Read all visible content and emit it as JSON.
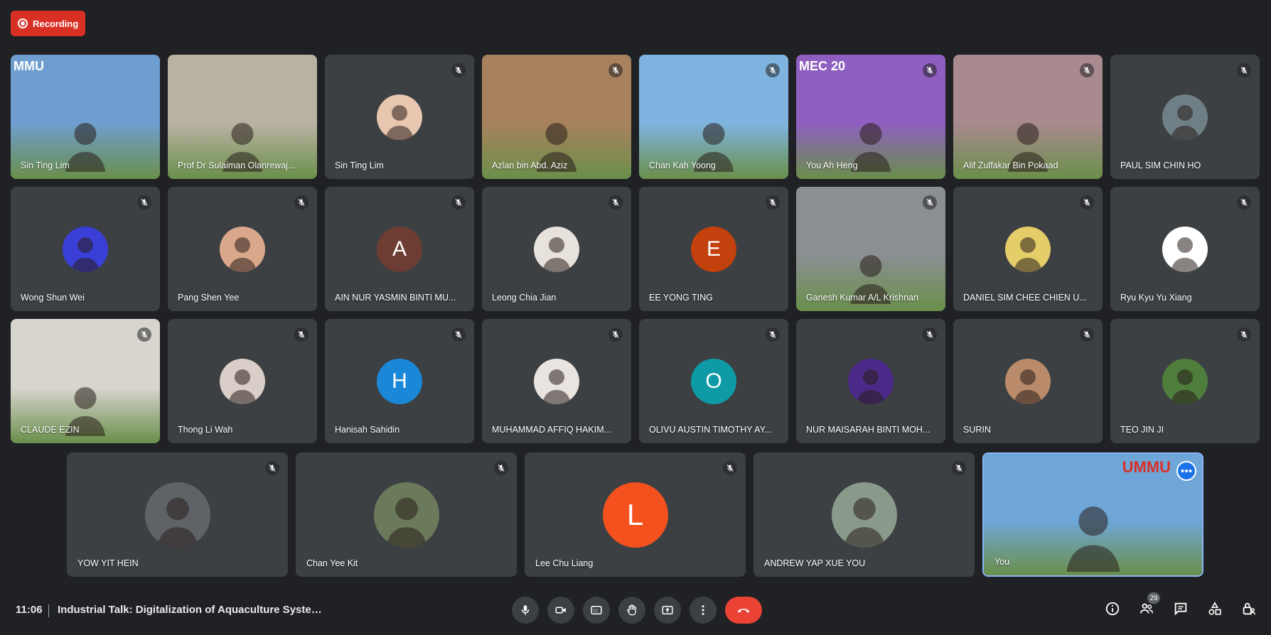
{
  "recording_label": "Recording",
  "tiles": [
    {
      "name": "Sin Ting Lim",
      "kind": "video",
      "bg": "#6e9ecf",
      "logo": "MMU",
      "muted": false
    },
    {
      "name": "Prof Dr Sulaiman Olanrewaj...",
      "kind": "video",
      "bg": "#b9b2a3",
      "muted": false
    },
    {
      "name": "Sin Ting Lim",
      "kind": "photo",
      "avatar_color": "#e8c6b0",
      "muted": true
    },
    {
      "name": "Azlan bin Abd. Aziz",
      "kind": "video",
      "bg": "#a8825e",
      "muted": true
    },
    {
      "name": "Chan Kah Yoong",
      "kind": "video",
      "bg": "#7fb4e0",
      "muted": true
    },
    {
      "name": "You Ah Heng",
      "kind": "video",
      "bg": "#8e5fc0",
      "logo": "MEC 20",
      "muted": true
    },
    {
      "name": "Alif Zulfakar Bin Pokaad",
      "kind": "video",
      "bg": "#a88a8f",
      "muted": true
    },
    {
      "name": "PAUL SIM CHIN HO",
      "kind": "photo",
      "avatar_color": "#6f7f86",
      "muted": true
    },
    {
      "name": "Wong Shun Wei",
      "kind": "photo",
      "avatar_color": "#3a3fd8",
      "muted": true
    },
    {
      "name": "Pang Shen Yee",
      "kind": "photo",
      "avatar_color": "#d9a78a",
      "muted": true
    },
    {
      "name": "AIN NUR YASMIN BINTI MU...",
      "kind": "initial",
      "initial": "A",
      "avatar_color": "#6d3d33",
      "muted": true
    },
    {
      "name": "Leong Chia Jian",
      "kind": "photo",
      "avatar_color": "#e8e2dc",
      "muted": true
    },
    {
      "name": "EE YONG TING",
      "kind": "initial",
      "initial": "E",
      "avatar_color": "#c2410c",
      "muted": true
    },
    {
      "name": "Ganesh Kumar A/L Krishnan",
      "kind": "video",
      "bg": "#8b8f93",
      "muted": true
    },
    {
      "name": "DANIEL SIM CHEE CHIEN U...",
      "kind": "photo",
      "avatar_color": "#e5cd6a",
      "muted": true
    },
    {
      "name": "Ryu Kyu Yu Xiang",
      "kind": "photo",
      "avatar_color": "#ffffff",
      "muted": true
    },
    {
      "name": "CLAUDE EZIN",
      "kind": "video",
      "bg": "#d8d5cf",
      "muted": true
    },
    {
      "name": "Thong Li Wah",
      "kind": "photo",
      "avatar_color": "#d9cfc8",
      "muted": true
    },
    {
      "name": "Hanisah Sahidin",
      "kind": "initial",
      "initial": "H",
      "avatar_color": "#1a88d6",
      "muted": true
    },
    {
      "name": "MUHAMMAD AFFIQ HAKIM...",
      "kind": "photo",
      "avatar_color": "#e9e4e0",
      "muted": true
    },
    {
      "name": "OLIVU AUSTIN TIMOTHY AY...",
      "kind": "initial",
      "initial": "O",
      "avatar_color": "#0f9ba6",
      "muted": true
    },
    {
      "name": "NUR MAISARAH BINTI MOH...",
      "kind": "photo",
      "avatar_color": "#4b2a8a",
      "muted": true
    },
    {
      "name": "SURIN",
      "kind": "photo",
      "avatar_color": "#b98b6a",
      "muted": true
    },
    {
      "name": "TEO JIN JI",
      "kind": "photo",
      "avatar_color": "#4f7d3b",
      "muted": true
    }
  ],
  "row4": [
    {
      "name": "YOW YIT HEIN",
      "kind": "photo",
      "avatar_color": "#5f6368",
      "muted": true
    },
    {
      "name": "Chan Yee Kit",
      "kind": "photo",
      "avatar_color": "#6b7a5a",
      "muted": true
    },
    {
      "name": "Lee Chu Liang",
      "kind": "initial",
      "initial": "L",
      "avatar_color": "#f4511e",
      "muted": true
    },
    {
      "name": "ANDREW YAP XUE YOU",
      "kind": "photo",
      "avatar_color": "#8a9a8a",
      "muted": true
    },
    {
      "name": "You",
      "kind": "self",
      "bg": "#6fa6d8",
      "logo": "UMMU",
      "muted": false
    }
  ],
  "bottom": {
    "time": "11:06",
    "title": "Industrial Talk: Digitalization of Aquaculture System ...",
    "participants_count": "29"
  },
  "colors": {
    "background": "#202124",
    "tile": "#3c4043",
    "record_red": "#d93025",
    "end_call": "#ea4335",
    "self_border": "#8ab4f8"
  }
}
